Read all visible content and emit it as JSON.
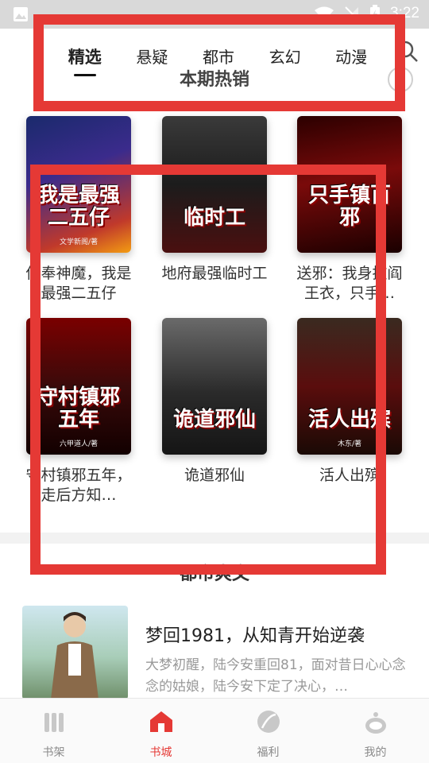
{
  "status_bar": {
    "time": "3:22"
  },
  "tabs": [
    {
      "label": "精选",
      "active": true
    },
    {
      "label": "悬疑",
      "active": false
    },
    {
      "label": "都市",
      "active": false
    },
    {
      "label": "玄幻",
      "active": false
    },
    {
      "label": "动漫",
      "active": false
    }
  ],
  "section1": {
    "title": "本期热销"
  },
  "books": [
    {
      "title": "供奉神魔，我是最强二五仔",
      "cover_text": "我是最强二五仔",
      "cover_author": "文学新阁/著"
    },
    {
      "title": "地府最强临时工",
      "cover_text": "临时工",
      "cover_author": ""
    },
    {
      "title": "送邪：我身披阎王衣，只手…",
      "cover_text": "只手镇百邪",
      "cover_author": ""
    },
    {
      "title": "守村镇邪五年，走后方知…",
      "cover_text": "守村镇邪五年",
      "cover_author": "六甲道人/著"
    },
    {
      "title": "诡道邪仙",
      "cover_text": "诡道邪仙",
      "cover_author": ""
    },
    {
      "title": "活人出殡",
      "cover_text": "活人出殡",
      "cover_author": "木东/著"
    }
  ],
  "section2": {
    "title": "都市爽文"
  },
  "featured": {
    "title": "梦回1981，从知青开始逆袭",
    "description": "大梦初醒，陆今安重回81，面对昔日心心念念的姑娘，陆今安下定了决心，…"
  },
  "bottom_nav": [
    {
      "label": "书架",
      "icon": "bookshelf-icon",
      "active": false
    },
    {
      "label": "书城",
      "icon": "bookstore-icon",
      "active": true
    },
    {
      "label": "福利",
      "icon": "welfare-leaf-icon",
      "active": false
    },
    {
      "label": "我的",
      "icon": "profile-icon",
      "active": false
    }
  ],
  "colors": {
    "accent": "#e53935",
    "annotation": "#e53935"
  }
}
